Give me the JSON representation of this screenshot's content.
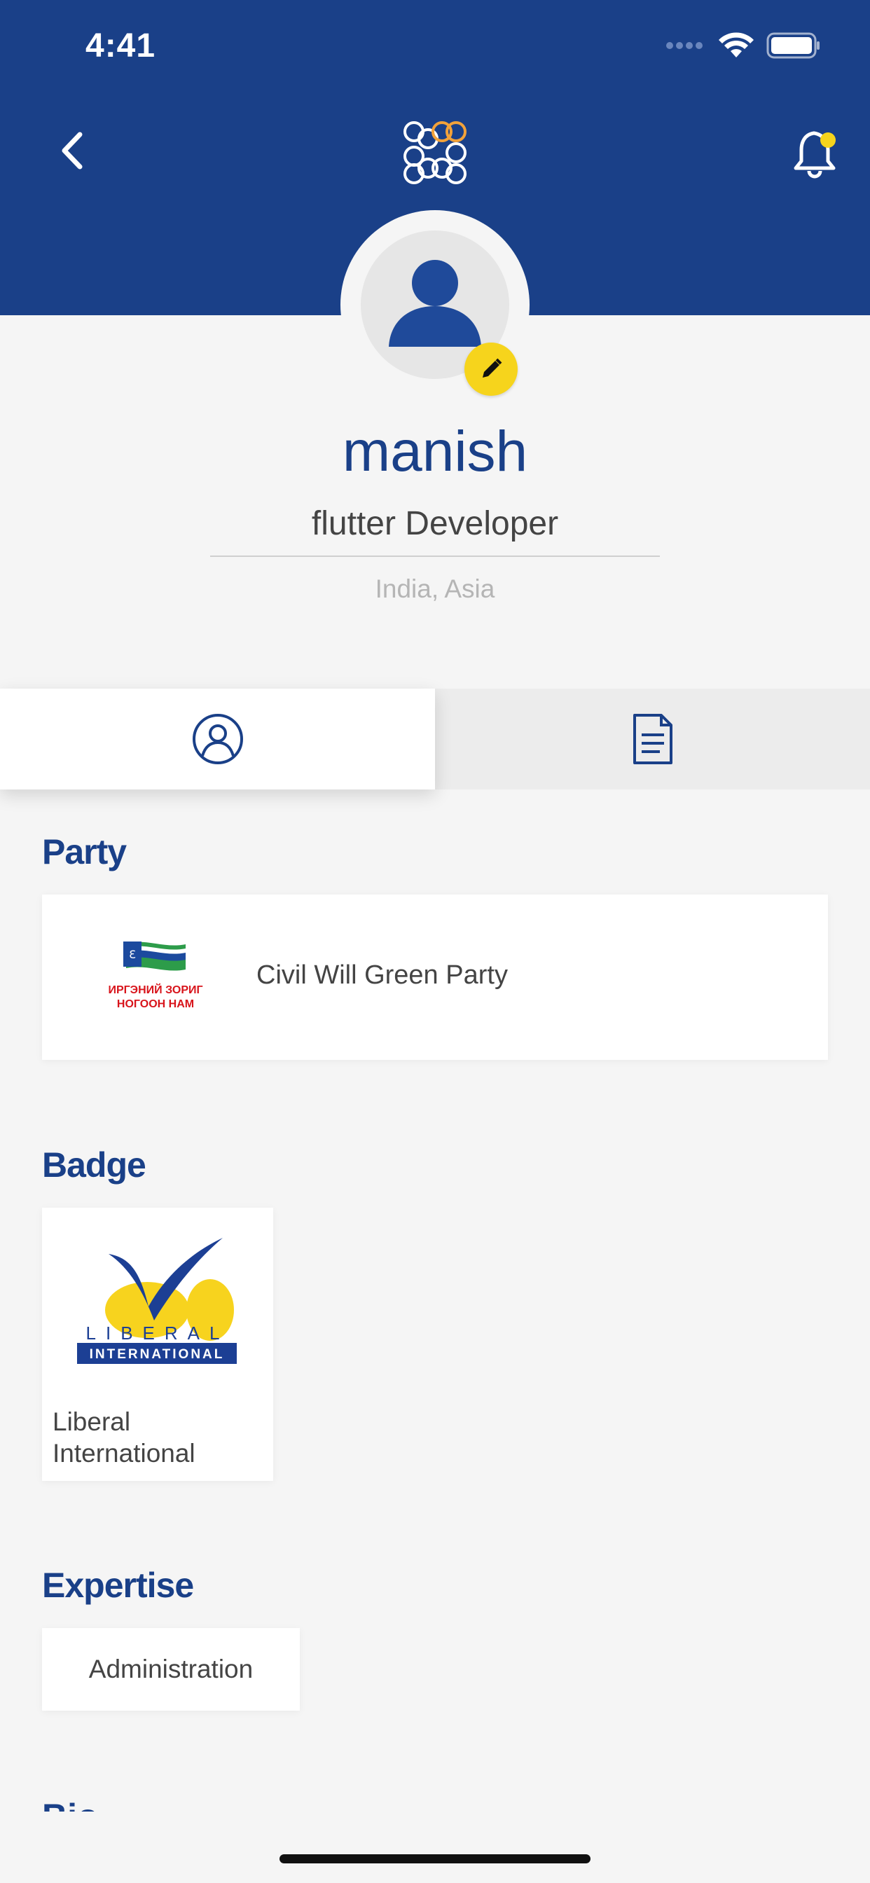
{
  "status_bar": {
    "time": "4:41"
  },
  "header": {
    "back_icon": "chevron-left-icon",
    "logo_icon": "app-logo-icon",
    "notification_icon": "bell-icon"
  },
  "profile": {
    "name": "manish",
    "role": "flutter Developer",
    "location": "India, Asia"
  },
  "tabs": [
    {
      "icon": "user-circle-icon",
      "selected": true
    },
    {
      "icon": "document-icon",
      "selected": false
    }
  ],
  "sections": {
    "party_title": "Party",
    "badge_title": "Badge",
    "expertise_title": "Expertise",
    "bio_title": "Bio"
  },
  "party": {
    "name": "Civil Will Green Party",
    "logo_text_line1": "ИРГЭНИЙ ЗОРИГ",
    "logo_text_line2": "НОГООН НАМ"
  },
  "badge": {
    "label": "Liberal International",
    "logo_text_top": "LIBERAL",
    "logo_text_bottom": "INTERNATIONAL"
  },
  "expertise": {
    "label": "Administration"
  },
  "colors": {
    "primary": "#1a4088",
    "accent": "#f6d41c",
    "background": "#f5f5f5"
  }
}
